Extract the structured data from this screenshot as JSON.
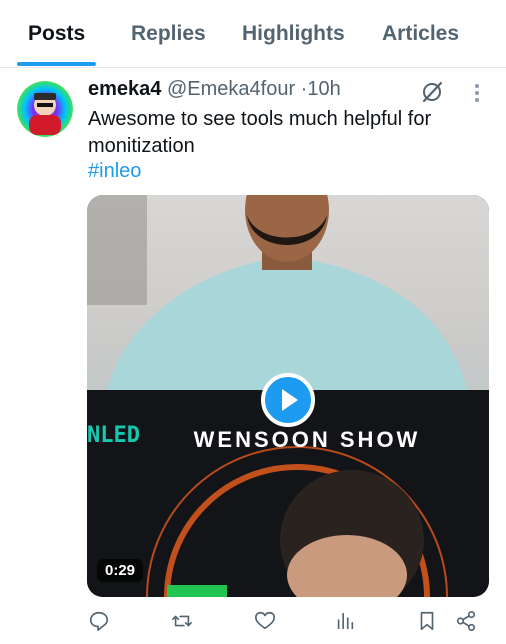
{
  "tabs": [
    {
      "label": "Posts",
      "active": true
    },
    {
      "label": "Replies",
      "active": false
    },
    {
      "label": "Highlights",
      "active": false
    },
    {
      "label": "Articles",
      "active": false
    }
  ],
  "post": {
    "author_name": "emeka4",
    "handle": "@Emeka4four",
    "separator": "·",
    "time": "10h",
    "text": "Awesome to see tools much helpful for monitization",
    "hashtag": "#inleo"
  },
  "video": {
    "duration": "0:29",
    "overlay_title": "WENSOON SHOW",
    "overlay_logo": "NLED"
  },
  "actions": [
    "reply-icon",
    "repost-icon",
    "like-icon",
    "views-icon",
    "bookmark-icon",
    "share-icon"
  ],
  "colors": {
    "accent": "#1d9bf0",
    "text": "#0f1419",
    "muted": "#536471"
  }
}
